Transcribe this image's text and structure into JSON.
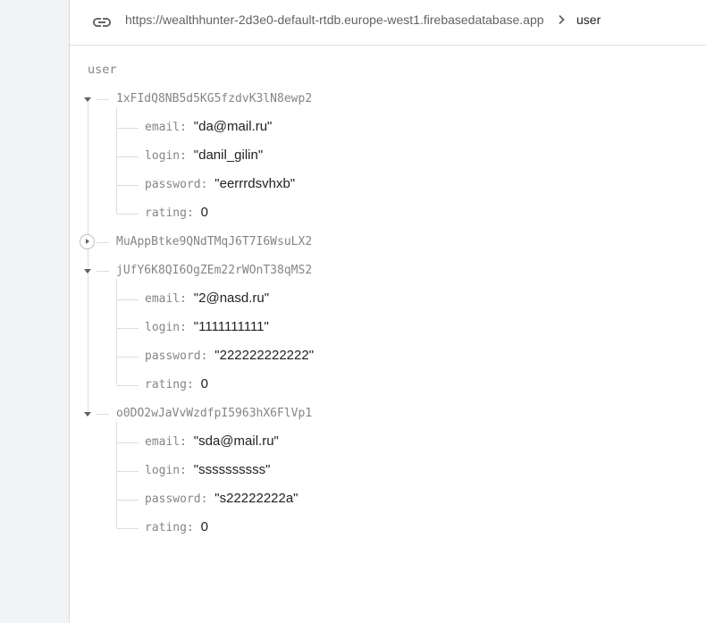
{
  "url_bar": {
    "url": "https://wealthhunter-2d3e0-default-rtdb.europe-west1.firebasedatabase.app",
    "breadcrumb": "user",
    "link_icon": "link-icon",
    "separator_icon": "chevron-right-icon"
  },
  "tree": {
    "root_key": "user",
    "nodes": [
      {
        "key": "1xFIdQ8NB5d5KG5fzdvK3lN8ewp2",
        "expanded": true,
        "fields": [
          {
            "key": "email",
            "value": "\"da@mail.ru\""
          },
          {
            "key": "login",
            "value": "\"danil_gilin\""
          },
          {
            "key": "password",
            "value": "\"eerrrdsvhxb\""
          },
          {
            "key": "rating",
            "value": "0"
          }
        ]
      },
      {
        "key": "MuAppBtke9QNdTMqJ6T7I6WsuLX2",
        "expanded": false,
        "fields": []
      },
      {
        "key": "jUfY6K8QI6OgZEm22rWOnT38qMS2",
        "expanded": true,
        "fields": [
          {
            "key": "email",
            "value": "\"2@nasd.ru\""
          },
          {
            "key": "login",
            "value": "\"1111111111\""
          },
          {
            "key": "password",
            "value": "\"222222222222\""
          },
          {
            "key": "rating",
            "value": "0"
          }
        ]
      },
      {
        "key": "o0DO2wJaVvWzdfpI5963hX6FlVp1",
        "expanded": true,
        "fields": [
          {
            "key": "email",
            "value": "\"sda@mail.ru\""
          },
          {
            "key": "login",
            "value": "\"ssssssssss\""
          },
          {
            "key": "password",
            "value": "\"s22222222a\""
          },
          {
            "key": "rating",
            "value": "0"
          }
        ]
      }
    ]
  },
  "colors": {
    "key_text": "#80868b",
    "value_text": "#202124",
    "tree_line": "#dadce0",
    "rail_bg": "#f1f3f4"
  }
}
